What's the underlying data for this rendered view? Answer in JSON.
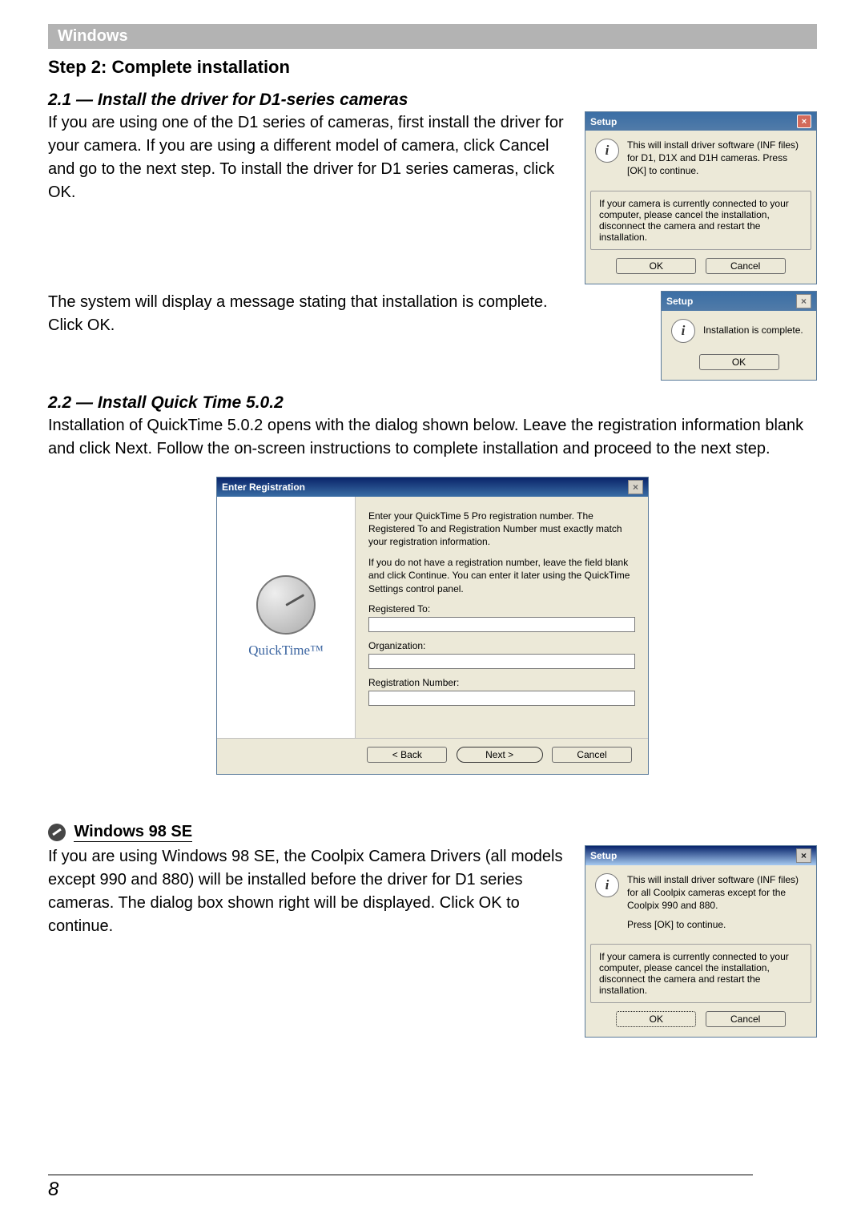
{
  "header": {
    "os_label": "Windows"
  },
  "step2": {
    "heading": "Step 2: Complete installation",
    "s21_heading": "2.1 — Install the driver for D1-series cameras",
    "s21_paragraph": "If you are using one of the D1 series of cameras, first install the driver for your camera.  If you are using a different model of camera, click Cancel and go to the next step.  To install the driver for D1 series cameras, click OK.",
    "s21_paragraph2": "The system will display a message stating that installation is complete.  Click OK.",
    "s22_heading": "2.2 — Install Quick Time 5.0.2",
    "s22_paragraph": "Installation of QuickTime 5.0.2 opens with the dialog shown below.  Leave the registration information blank and click Next.  Follow the on-screen instructions to complete installation and proceed to the next step."
  },
  "dialog_setup1": {
    "title": "Setup",
    "message": "This will install driver software (INF files) for D1, D1X and D1H cameras. Press [OK] to continue.",
    "warning": "If your camera is currently connected to your computer, please cancel the installation, disconnect the camera and restart the installation.",
    "ok": "OK",
    "cancel": "Cancel",
    "close": "×"
  },
  "dialog_setup2": {
    "title": "Setup",
    "message": "Installation is complete.",
    "ok": "OK",
    "close": "×"
  },
  "dialog_quicktime": {
    "title": "Enter Registration",
    "text1": "Enter your QuickTime 5 Pro registration number. The Registered To and Registration Number must exactly match your registration information.",
    "text2": "If you do not have a registration number, leave the field blank and click Continue. You can enter it later using the QuickTime Settings control panel.",
    "label_registered_to": "Registered To:",
    "label_organization": "Organization:",
    "label_registration_number": "Registration Number:",
    "brand": "QuickTime™",
    "back": "< Back",
    "next": "Next >",
    "cancel": "Cancel",
    "close": "×"
  },
  "note_win98": {
    "label": "Windows 98 SE",
    "paragraph": "If you are using Windows 98 SE, the Coolpix Camera Drivers (all models except 990 and 880) will be installed before the driver for D1 series cameras.  The dialog box shown right will be displayed.  Click OK to continue."
  },
  "dialog_setup3": {
    "title": "Setup",
    "message": "This will install driver software (INF files) for all Coolpix cameras except for the Coolpix 990 and 880.",
    "message2": "Press [OK] to continue.",
    "warning": "If your camera is currently connected to your computer, please cancel the installation, disconnect the camera and restart the installation.",
    "ok": "OK",
    "cancel": "Cancel",
    "close": "×"
  },
  "page_number": "8"
}
